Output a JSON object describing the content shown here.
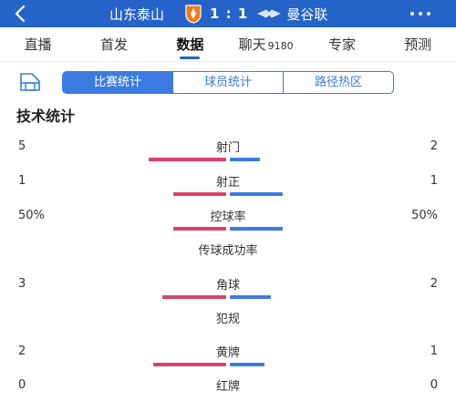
{
  "header": {
    "home_team": "山东泰山",
    "score": "1 : 1",
    "away_team": "曼谷联",
    "colors": {
      "bar": "#2563c9"
    }
  },
  "tabs": [
    {
      "label": "直播",
      "count": ""
    },
    {
      "label": "首发",
      "count": ""
    },
    {
      "label": "数据",
      "count": "",
      "active": true
    },
    {
      "label": "聊天",
      "count": "9180"
    },
    {
      "label": "专家",
      "count": ""
    },
    {
      "label": "预测",
      "count": ""
    }
  ],
  "subtabs": [
    {
      "label": "比赛统计",
      "active": true
    },
    {
      "label": "球员统计"
    },
    {
      "label": "路径热区"
    }
  ],
  "section_title": "技术统计",
  "stats": [
    {
      "label": "射门",
      "home": "5",
      "away": "2",
      "home_bar": 0.34,
      "away_bar": 0.13
    },
    {
      "label": "射正",
      "home": "1",
      "away": "1",
      "home_bar": 0.23,
      "away_bar": 0.23
    },
    {
      "label": "控球率",
      "home": "50%",
      "away": "50%",
      "home_bar": 0.23,
      "away_bar": 0.23
    },
    {
      "label": "传球成功率",
      "home": "",
      "away": "",
      "home_bar": 0,
      "away_bar": 0
    },
    {
      "label": "角球",
      "home": "3",
      "away": "2",
      "home_bar": 0.28,
      "away_bar": 0.18
    },
    {
      "label": "犯规",
      "home": "",
      "away": "",
      "home_bar": 0,
      "away_bar": 0
    },
    {
      "label": "黄牌",
      "home": "2",
      "away": "1",
      "home_bar": 0.32,
      "away_bar": 0.15
    },
    {
      "label": "红牌",
      "home": "0",
      "away": "0",
      "home_bar": 0,
      "away_bar": 0
    }
  ],
  "colors": {
    "home": "#d9426d",
    "away": "#3b7be0"
  }
}
